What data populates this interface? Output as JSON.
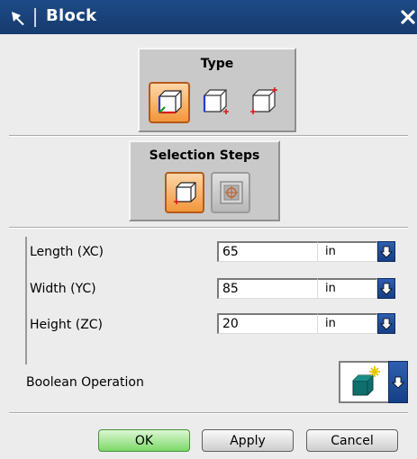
{
  "window": {
    "title": "Block",
    "pin_icon": "pin-icon",
    "close_icon": "close-icon"
  },
  "type_group": {
    "title": "Type",
    "options": [
      {
        "icon": "origin-and-edge-lengths-icon",
        "selected": true
      },
      {
        "icon": "two-points-and-height-icon",
        "selected": false
      },
      {
        "icon": "two-diagonal-points-icon",
        "selected": false
      }
    ]
  },
  "selection_steps": {
    "title": "Selection Steps",
    "steps": [
      {
        "icon": "origin-point-step-icon",
        "selected": true
      },
      {
        "icon": "target-body-step-icon",
        "enabled": false
      }
    ]
  },
  "dimensions": [
    {
      "label": "Length (XC)",
      "value": "65",
      "unit": "in"
    },
    {
      "label": "Width (YC)",
      "value": "85",
      "unit": "in"
    },
    {
      "label": "Height (ZC)",
      "value": "20",
      "unit": "in"
    }
  ],
  "boolean": {
    "label": "Boolean Operation",
    "icon": "create-body-icon"
  },
  "buttons": {
    "ok": "OK",
    "apply": "Apply",
    "cancel": "Cancel"
  },
  "colors": {
    "title_bar": "#1d4a86",
    "active_icon": "#f2963a",
    "ok_button": "#7dd96a",
    "dropdown": "#1c4a93"
  }
}
